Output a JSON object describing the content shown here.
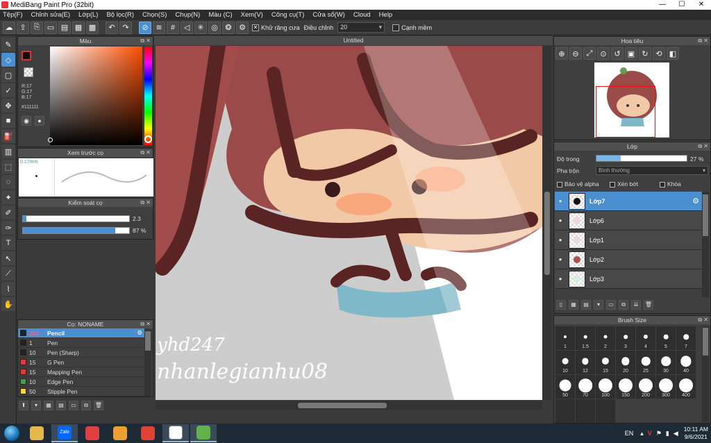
{
  "window": {
    "title": "MediBang Paint Pro (32bit)",
    "minimize": "—",
    "maximize": "☐",
    "close": "✕"
  },
  "menu": [
    "Tệp(F)",
    "Chỉnh sửa(E)",
    "Lớp(L)",
    "Bộ lọc(R)",
    "Chọn(S)",
    "Chụp(N)",
    "Màu (C)",
    "Xem(V)",
    "Công cụ(T)",
    "Cửa sổ(W)",
    "Cloud",
    "Help"
  ],
  "toolbar": {
    "antialias_label": "Khử răng cưa",
    "adjust_label": "Điều chỉnh",
    "adjust_value": "20",
    "soft_edge_label": "Cạnh mềm"
  },
  "color_panel": {
    "title": "Màu",
    "r": "R:17",
    "g": "G:17",
    "b": "B:17",
    "hex": "#111111",
    "foreground": "#111111"
  },
  "preview_panel": {
    "title": "Xem trước cọ",
    "size": "0.17mm"
  },
  "control_panel": {
    "title": "Kiểm soát cọ",
    "size_value": "2.3",
    "opacity_value": "87 %",
    "size_fraction": 0.03,
    "opacity_fraction": 0.87
  },
  "brush_panel": {
    "title": "Cọ: NONAME",
    "brushes": [
      {
        "size": "204",
        "name": "Pencil",
        "color": "#222222",
        "selected": true
      },
      {
        "size": "1",
        "name": "Pen",
        "color": "#222222"
      },
      {
        "size": "10",
        "name": "Pen (Sharp)",
        "color": "#222222"
      },
      {
        "size": "15",
        "name": "G Pen",
        "color": "#e53935"
      },
      {
        "size": "15",
        "name": "Mapping Pen",
        "color": "#e53935"
      },
      {
        "size": "10",
        "name": "Edge Pen",
        "color": "#43a047"
      },
      {
        "size": "50",
        "name": "Stipple Pen",
        "color": "#fdd835"
      }
    ]
  },
  "canvas": {
    "tab_title": "Untitled",
    "watermark_line1": "yhd247",
    "watermark_line2": "nhanlegianhu08"
  },
  "navigator": {
    "title": "Hoa tiêu"
  },
  "layer_panel": {
    "title": "Lớp",
    "opacity_label": "Độ trong",
    "opacity_value": "27 %",
    "opacity_fraction": 0.27,
    "blend_label": "Pha trộn",
    "blend_value": "Bình thường",
    "protect_alpha": "Bảo vệ alpha",
    "clipping": "Xén bớt",
    "lock": "Khóa",
    "layers": [
      {
        "name": "Lớp7",
        "selected": true
      },
      {
        "name": "Lớp6"
      },
      {
        "name": "Lớp1"
      },
      {
        "name": "Lớp2"
      },
      {
        "name": "Lớp3"
      }
    ]
  },
  "brush_size_panel": {
    "title": "Brush Size",
    "sizes": [
      "1",
      "1.5",
      "2",
      "3",
      "4",
      "5",
      "7",
      "10",
      "12",
      "15",
      "20",
      "25",
      "30",
      "40",
      "50",
      "70",
      "100",
      "150",
      "200",
      "300",
      "400",
      "",
      "",
      ""
    ]
  },
  "taskbar": {
    "apps": [
      {
        "label": "",
        "icon": "folder-icon",
        "color": "#e6b84a"
      },
      {
        "label": "Zalo",
        "icon": "zalo-icon",
        "color": "#0068ff"
      },
      {
        "label": "",
        "icon": "app-icon",
        "color": "#e04040"
      },
      {
        "label": "",
        "icon": "notes-icon",
        "color": "#f0a030"
      },
      {
        "label": "",
        "icon": "chrome-icon",
        "color": "#dd4433"
      },
      {
        "label": "",
        "icon": "paint-icon",
        "color": "#ffffff"
      },
      {
        "label": "",
        "icon": "medibang-icon",
        "color": "#5fb34a"
      }
    ],
    "language": "EN",
    "time": "10:11 AM",
    "date": "9/6/2021"
  }
}
